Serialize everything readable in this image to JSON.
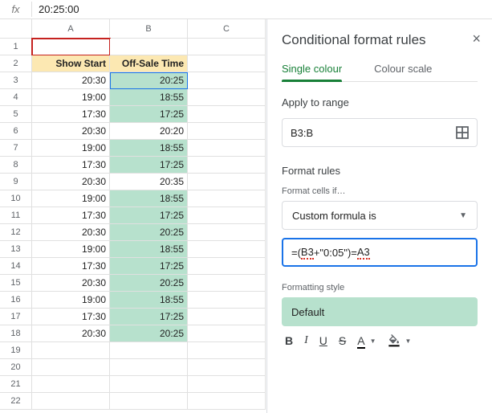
{
  "formula_bar": {
    "label": "fx",
    "value": "20:25:00"
  },
  "columns": [
    "A",
    "B",
    "C"
  ],
  "rows": [
    1,
    2,
    3,
    4,
    5,
    6,
    7,
    8,
    9,
    10,
    11,
    12,
    13,
    14,
    15,
    16,
    17,
    18,
    19,
    20,
    21,
    22
  ],
  "headers": {
    "a": "Show Start",
    "b": "Off-Sale Time"
  },
  "data": [
    {
      "a": "20:30",
      "b": "20:25",
      "g": true
    },
    {
      "a": "19:00",
      "b": "18:55",
      "g": true
    },
    {
      "a": "17:30",
      "b": "17:25",
      "g": true
    },
    {
      "a": "20:30",
      "b": "20:20",
      "g": false
    },
    {
      "a": "19:00",
      "b": "18:55",
      "g": true
    },
    {
      "a": "17:30",
      "b": "17:25",
      "g": true
    },
    {
      "a": "20:30",
      "b": "20:35",
      "g": false
    },
    {
      "a": "19:00",
      "b": "18:55",
      "g": true
    },
    {
      "a": "17:30",
      "b": "17:25",
      "g": true
    },
    {
      "a": "20:30",
      "b": "20:25",
      "g": true
    },
    {
      "a": "19:00",
      "b": "18:55",
      "g": true
    },
    {
      "a": "17:30",
      "b": "17:25",
      "g": true
    },
    {
      "a": "20:30",
      "b": "20:25",
      "g": true
    },
    {
      "a": "19:00",
      "b": "18:55",
      "g": true
    },
    {
      "a": "17:30",
      "b": "17:25",
      "g": true
    },
    {
      "a": "20:30",
      "b": "20:25",
      "g": true
    }
  ],
  "panel": {
    "title": "Conditional format rules",
    "tab1": "Single colour",
    "tab2": "Colour scale",
    "apply_label": "Apply to range",
    "range": "B3:B",
    "format_rules": "Format rules",
    "format_cells_if": "Format cells if…",
    "formula_type": "Custom formula is",
    "formula_eq": "=(",
    "formula_b3": "B3",
    "formula_mid": "+\"0:05\")=",
    "formula_a3": "A3",
    "formatting_style": "Formatting style",
    "style_name": "Default",
    "toolbar": {
      "b": "B",
      "i": "I",
      "u": "U",
      "s": "S",
      "a": "A"
    }
  }
}
